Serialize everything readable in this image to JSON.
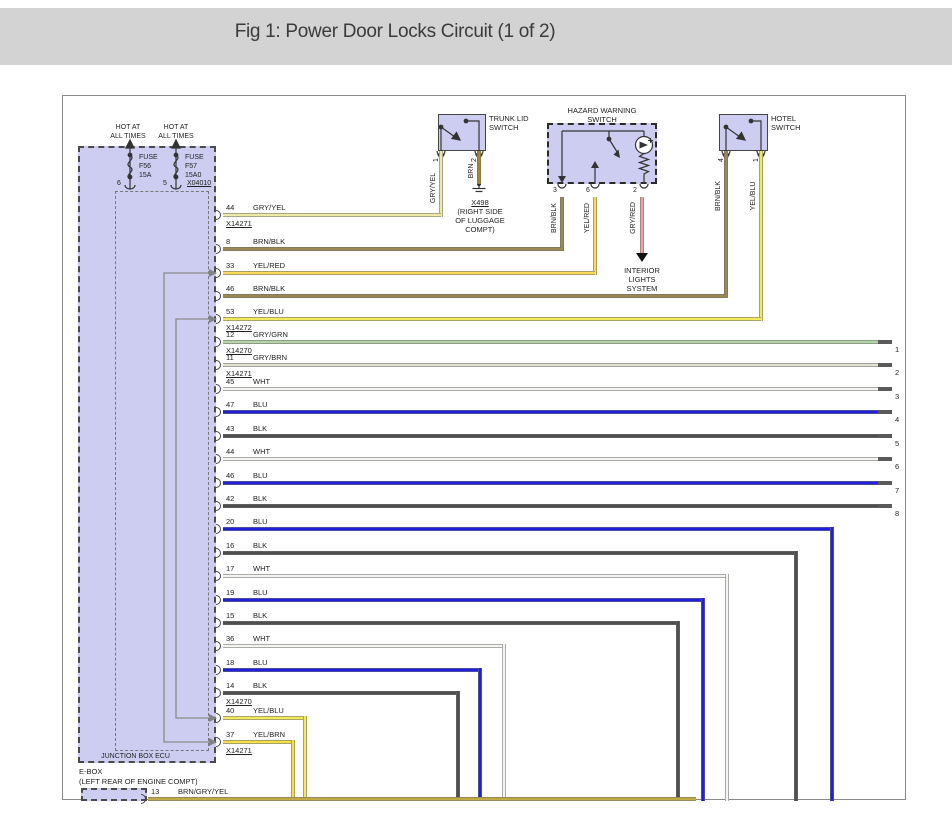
{
  "header": {
    "title": "Fig 1: Power Door Locks Circuit (1 of 2)"
  },
  "power": {
    "hot1_line1": "HOT AT",
    "hot1_line2": "ALL TIMES",
    "hot2_line1": "HOT AT",
    "hot2_line2": "ALL TIMES",
    "fuse1": {
      "label": "FUSE",
      "id": "F56",
      "rating": "15A",
      "pin": "6"
    },
    "fuse2": {
      "label": "FUSE",
      "id": "F57",
      "rating": "15A0",
      "pin": "5"
    },
    "connector": "X04010"
  },
  "junction_box": {
    "label": "JUNCTION BOX ECU"
  },
  "ebox": {
    "label": "E-BOX",
    "location": "(LEFT REAR OF ENGINE COMPT)"
  },
  "switches": {
    "trunk": {
      "name_line1": "TRUNK LID",
      "name_line2": "SWITCH",
      "pin1": "1",
      "pin2": "2",
      "color1": "GRY/YEL",
      "color2": "BRN",
      "ground_id": "X498",
      "ground_loc1": "(RIGHT SIDE",
      "ground_loc2": "OF LUGGAGE",
      "ground_loc3": "COMPT)"
    },
    "hazard": {
      "name_line1": "HAZARD WARNING",
      "name_line2": "SWITCH",
      "pin1": "3",
      "pin2": "6",
      "pin3": "2",
      "color1": "BRN/BLK",
      "color2": "YEL/RED",
      "color3": "GRY/RED",
      "dest_line1": "INTERIOR",
      "dest_line2": "LIGHTS",
      "dest_line3": "SYSTEM"
    },
    "hotel": {
      "name_line1": "HOTEL",
      "name_line2": "SWITCH",
      "pin1": "4",
      "pin2": "1",
      "color1": "BRN/BLK",
      "color2": "YEL/BLU"
    }
  },
  "wires": [
    {
      "pin": "44",
      "color": "GRY/YEL",
      "key": "GRY_YEL",
      "conn": "X14271"
    },
    {
      "pin": "8",
      "color": "BRN/BLK",
      "key": "BRN_BLK"
    },
    {
      "pin": "33",
      "color": "YEL/RED",
      "key": "YEL_RED"
    },
    {
      "pin": "46",
      "color": "BRN/BLK",
      "key": "BRN_BLK"
    },
    {
      "pin": "53",
      "color": "YEL/BLU",
      "key": "YEL_BLU",
      "conn": "X14272"
    },
    {
      "pin": "12",
      "color": "GRY/GRN",
      "key": "GRY_GRN",
      "conn": "X14270"
    },
    {
      "pin": "11",
      "color": "GRY/BRN",
      "key": "GRY_BRN",
      "conn": "X14271"
    },
    {
      "pin": "45",
      "color": "WHT",
      "key": "WHT"
    },
    {
      "pin": "47",
      "color": "BLU",
      "key": "BLU"
    },
    {
      "pin": "43",
      "color": "BLK",
      "key": "BLK"
    },
    {
      "pin": "44",
      "color": "WHT",
      "key": "WHT"
    },
    {
      "pin": "46",
      "color": "BLU",
      "key": "BLU"
    },
    {
      "pin": "42",
      "color": "BLK",
      "key": "BLK"
    },
    {
      "pin": "20",
      "color": "BLU",
      "key": "BLU"
    },
    {
      "pin": "16",
      "color": "BLK",
      "key": "BLK"
    },
    {
      "pin": "17",
      "color": "WHT",
      "key": "WHT"
    },
    {
      "pin": "19",
      "color": "BLU",
      "key": "BLU"
    },
    {
      "pin": "15",
      "color": "BLK",
      "key": "BLK"
    },
    {
      "pin": "36",
      "color": "WHT",
      "key": "WHT"
    },
    {
      "pin": "18",
      "color": "BLU",
      "key": "BLU"
    },
    {
      "pin": "14",
      "color": "BLK",
      "key": "BLK",
      "conn": "X14270"
    },
    {
      "pin": "40",
      "color": "YEL/BLU",
      "key": "YEL_BLU"
    },
    {
      "pin": "37",
      "color": "YEL/BRN",
      "key": "YEL_BRN",
      "conn": "X14271"
    },
    {
      "pin": "13",
      "color": "BRN/GRY/YEL",
      "key": "BRN_GRY_YEL"
    }
  ],
  "right_pins": [
    "1",
    "2",
    "3",
    "4",
    "5",
    "6",
    "7",
    "8"
  ],
  "palette": {
    "GRY_YEL": "#eeeaa6",
    "BRN": "#a8862e",
    "BRN_BLK": "#9a8a52",
    "YEL_RED": "#ffd957",
    "GRY_RED": "#f0a0a0",
    "YEL_BLU": "#f2e95c",
    "GRY_GRN": "#b4d6a6",
    "GRY_BRN": "#e2e0d2",
    "WHT": "#f4f4f1",
    "BLU": "#2121dc",
    "BLK": "#4e4e4e",
    "YEL_BRN": "#f2e04a",
    "BRN_GRY_YEL": "#c2aa44",
    "accent_fill": "#cdcdf2"
  }
}
